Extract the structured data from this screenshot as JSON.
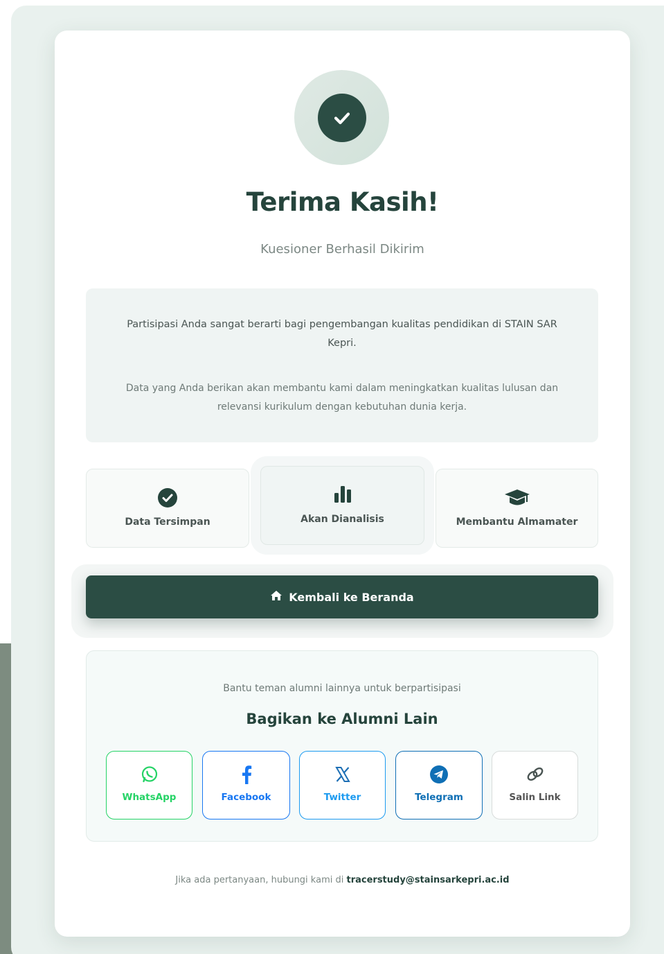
{
  "header": {
    "title": "Terima Kasih!",
    "subtitle": "Kuesioner Berhasil Dikirim"
  },
  "info": {
    "paragraph1": "Partisipasi Anda sangat berarti bagi pengembangan kualitas pendidikan di STAIN SAR Kepri.",
    "paragraph2": "Data yang Anda berikan akan membantu kami dalam meningkatkan kualitas lulusan dan relevansi kurikulum dengan kebutuhan dunia kerja."
  },
  "status_cards": [
    {
      "label": "Data Tersimpan",
      "icon": "check-circle-icon"
    },
    {
      "label": "Akan Dianalisis",
      "icon": "bar-chart-icon"
    },
    {
      "label": "Membantu Almamater",
      "icon": "graduation-cap-icon"
    }
  ],
  "home_button": {
    "label": "Kembali ke Beranda",
    "icon": "home-icon"
  },
  "share": {
    "hint": "Bantu teman alumni lainnya untuk berpartisipasi",
    "title": "Bagikan ke Alumni Lain",
    "buttons": [
      {
        "label": "WhatsApp",
        "icon": "whatsapp-icon",
        "color": "#25d366"
      },
      {
        "label": "Facebook",
        "icon": "facebook-icon",
        "color": "#1877f2"
      },
      {
        "label": "Twitter",
        "icon": "x-twitter-icon",
        "color": "#1d9bf0"
      },
      {
        "label": "Telegram",
        "icon": "telegram-icon",
        "color": "#0f6fb5"
      },
      {
        "label": "Salin Link",
        "icon": "link-icon",
        "color": "#555555"
      }
    ]
  },
  "footer": {
    "text": "Jika ada pertanyaan, hubungi kami di",
    "email": "tracerstudy@stainsarkepri.ac.id"
  },
  "colors": {
    "primary": "#2b4d44",
    "background": "#e9f1ee"
  }
}
